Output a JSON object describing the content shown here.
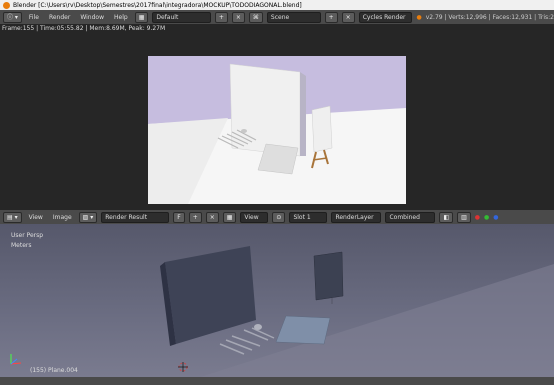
{
  "window": {
    "title": "Blender [C:\\Users\\rv\\Desktop\\Semestres\\2017final\\integradora\\MOCKUP\\TODODIAGONAL.blend]"
  },
  "topbar": {
    "menus": [
      "File",
      "Render",
      "Window",
      "Help"
    ],
    "layout": "Default",
    "scene": "Scene",
    "engine": "Cycles Render",
    "stats": "v2.79 | Verts:12,996 | Faces:12,931 | Tris:2"
  },
  "render": {
    "info": "Frame:155 | Time:05:55.82 | Mem:8.69M, Peak: 9.27M"
  },
  "image_editor_header": {
    "view": "View",
    "image": "Image",
    "image_name": "Render Result",
    "view2": "View",
    "slot": "Slot 1",
    "layer": "RenderLayer",
    "pass": "Combined"
  },
  "viewport": {
    "mode": "User Persp",
    "units": "Meters",
    "object": "(155) Plane.004"
  },
  "colors": {
    "render_bg": "#c6bddf",
    "render_floor": "#f6f6f6",
    "viewport_bg": "#6b6d82",
    "header": "#4a4a4a"
  }
}
